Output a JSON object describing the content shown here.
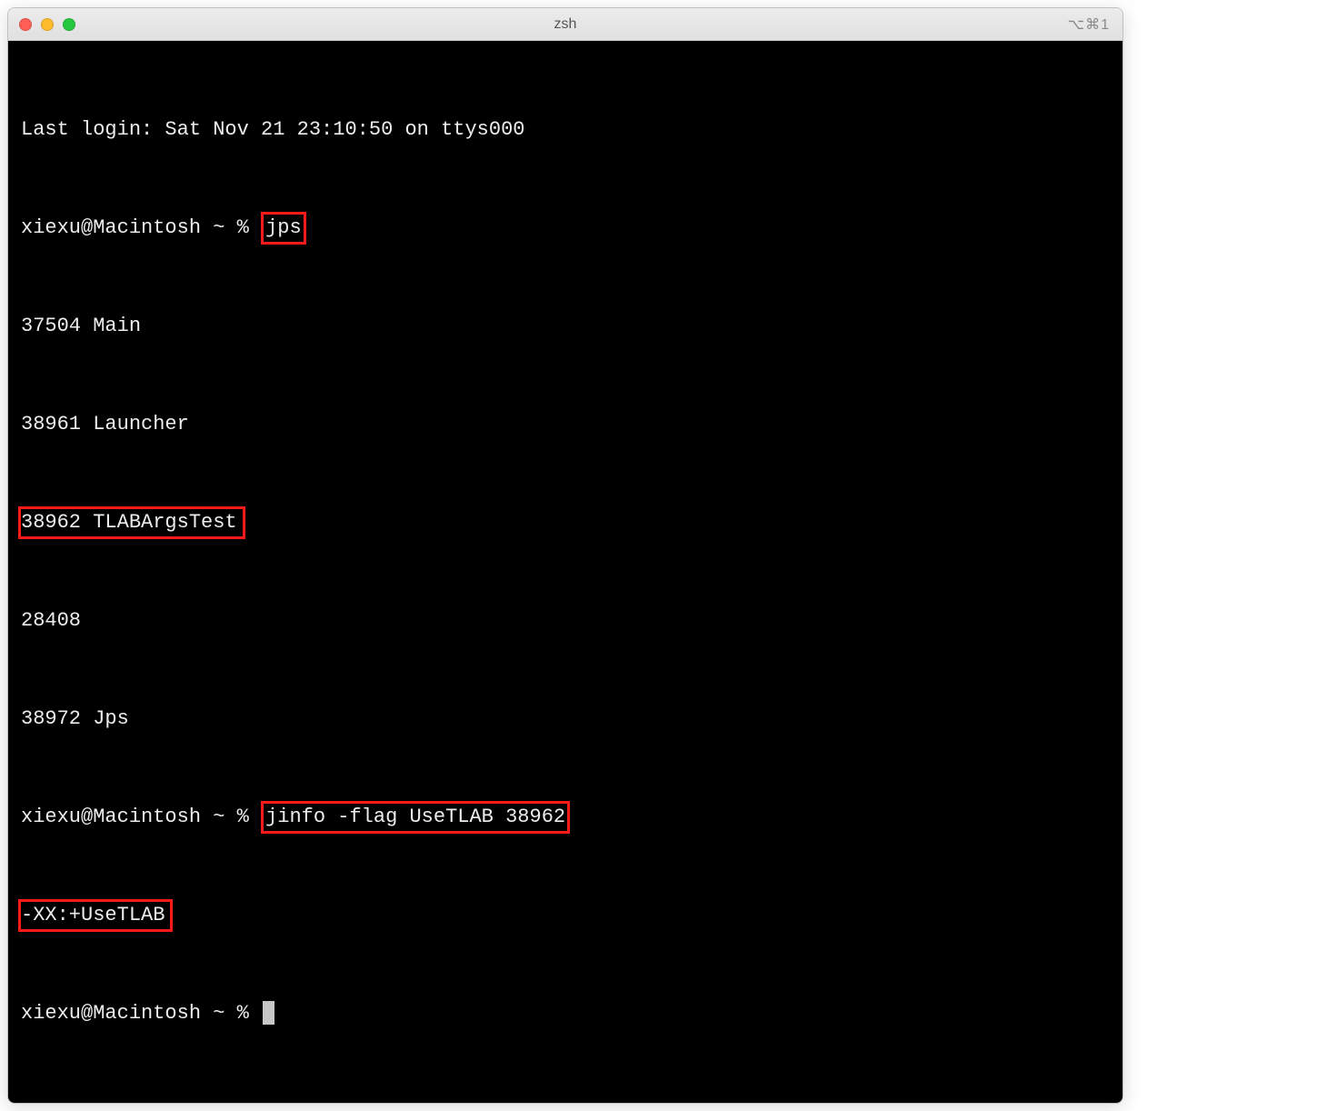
{
  "titlebar": {
    "title": "zsh",
    "right": "⌥⌘1"
  },
  "terminal": {
    "last_login": "Last login: Sat Nov 21 23:10:50 on ttys000",
    "prompt1_prefix": "xiexu@Macintosh ~ % ",
    "cmd1": "jps",
    "jps_out": [
      "37504 Main",
      "38961 Launcher",
      "38962 TLABArgsTest",
      "28408",
      "38972 Jps"
    ],
    "prompt2_prefix": "xiexu@Macintosh ~ % ",
    "cmd2": "jinfo -flag UseTLAB 38962",
    "jinfo_out": "-XX:+UseTLAB",
    "prompt3": "xiexu@Macintosh ~ % "
  }
}
